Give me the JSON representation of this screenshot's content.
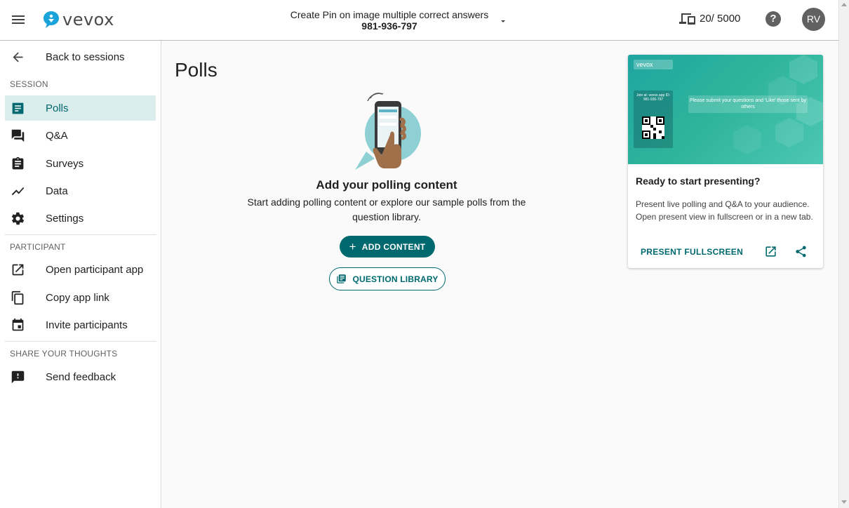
{
  "header": {
    "logo_text": "vevox",
    "session_name": "Create Pin on image multiple correct answers",
    "session_code": "981-936-797",
    "participants_count": "20/ 5000",
    "help_label": "?",
    "avatar_initials": "RV"
  },
  "sidebar": {
    "back_label": "Back to sessions",
    "session_section": "SESSION",
    "session_items": [
      {
        "label": "Polls",
        "icon": "polls-icon"
      },
      {
        "label": "Q&A",
        "icon": "qa-icon"
      },
      {
        "label": "Surveys",
        "icon": "clipboard-icon"
      },
      {
        "label": "Data",
        "icon": "chart-line-icon"
      },
      {
        "label": "Settings",
        "icon": "gear-icon"
      }
    ],
    "participant_section": "PARTICIPANT",
    "participant_items": [
      {
        "label": "Open participant app",
        "icon": "open-in-new-icon"
      },
      {
        "label": "Copy app link",
        "icon": "copy-icon"
      },
      {
        "label": "Invite participants",
        "icon": "calendar-icon"
      }
    ],
    "feedback_section": "SHARE YOUR THOUGHTS",
    "feedback_items": [
      {
        "label": "Send feedback",
        "icon": "feedback-icon"
      }
    ]
  },
  "main": {
    "page_title": "Polls",
    "empty_title": "Add your polling content",
    "empty_text": "Start adding polling content or explore our sample polls from the question library.",
    "add_button": "ADD CONTENT",
    "library_button": "QUESTION LIBRARY"
  },
  "card": {
    "preview_logo": "vevox",
    "preview_join": "Join at: vevox.app ID: 981-936-797",
    "preview_message": "Please submit your questions and 'Like' those sent by others",
    "title": "Ready to start presenting?",
    "text": "Present live polling and Q&A to your audience. Open present view in fullscreen or in a new tab.",
    "present_label": "PRESENT FULLSCREEN"
  },
  "colors": {
    "accent": "#00696f",
    "active_bg": "#dbeced",
    "logo_blue": "#1aa3d9"
  }
}
